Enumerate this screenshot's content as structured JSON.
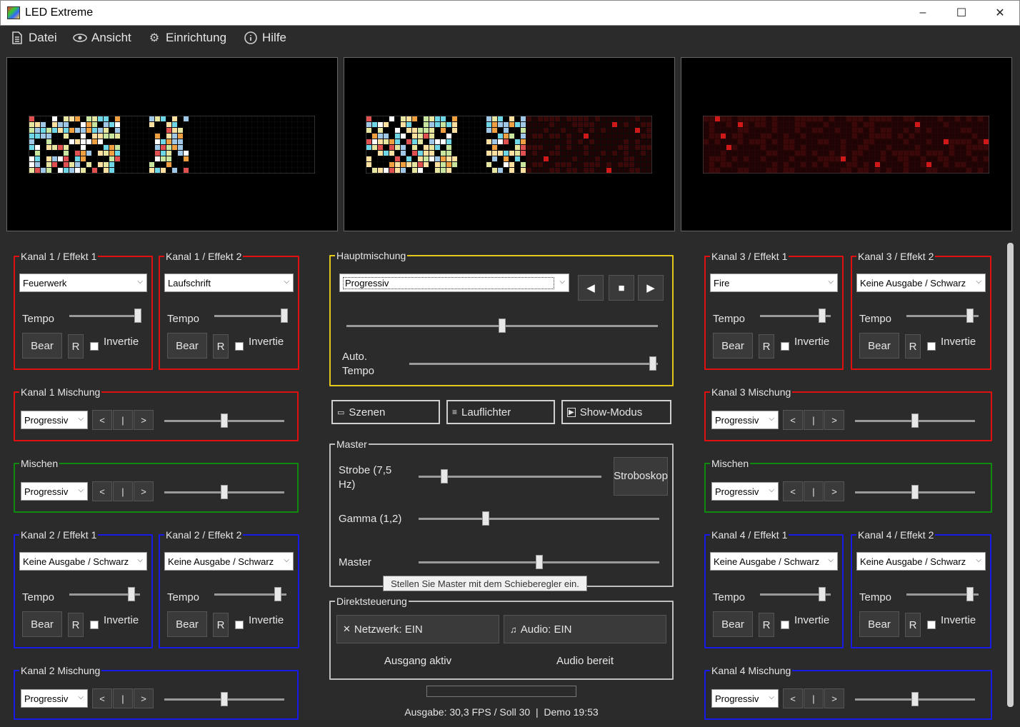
{
  "window": {
    "title": "LED Extreme",
    "minimize": "–",
    "maximize": "☐",
    "close": "✕"
  },
  "menu": [
    {
      "label": "Datei",
      "icon": "document-icon"
    },
    {
      "label": "Ansicht",
      "icon": "eye-icon"
    },
    {
      "label": "Einrichtung",
      "icon": "gear-icon"
    },
    {
      "label": "Hilfe",
      "icon": "info-icon"
    }
  ],
  "effects": {
    "k1e1": {
      "title": "Kanal 1 / Effekt 1",
      "value": "Feuerwerk",
      "tempo": 0.97
    },
    "k1e2": {
      "title": "Kanal 1 / Effekt 2",
      "value": "Laufschrift",
      "tempo": 0.97
    },
    "k2e1": {
      "title": "Kanal 2 / Effekt 1",
      "value": "Keine Ausgabe / Schwarz",
      "tempo": 0.88
    },
    "k2e2": {
      "title": "Kanal 2 / Effekt 2",
      "value": "Keine Ausgabe / Schwarz",
      "tempo": 0.88
    },
    "k3e1": {
      "title": "Kanal 3 / Effekt 1",
      "value": "Fire",
      "tempo": 0.88
    },
    "k3e2": {
      "title": "Kanal 3 / Effekt 2",
      "value": "Keine Ausgabe / Schwarz",
      "tempo": 0.88
    },
    "k4e1": {
      "title": "Kanal 4 / Effekt 1",
      "value": "Keine Ausgabe / Schwarz",
      "tempo": 0.88
    },
    "k4e2": {
      "title": "Kanal 4 / Effekt 2",
      "value": "Keine Ausgabe / Schwarz",
      "tempo": 0.88
    }
  },
  "effect_common": {
    "tempo_label": "Tempo",
    "bear_label": "Bear",
    "r_label": "R",
    "invert_label": "Invertie"
  },
  "mixes": {
    "k1mix": {
      "title": "Kanal 1 Mischung",
      "value": "Progressiv",
      "level": 0.5
    },
    "mix_left": {
      "title": "Mischen",
      "value": "Progressiv",
      "level": 0.5
    },
    "k2mix": {
      "title": "Kanal 2 Mischung",
      "value": "Progressiv",
      "level": 0.5
    },
    "k3mix": {
      "title": "Kanal 3 Mischung",
      "value": "Progressiv",
      "level": 0.5
    },
    "mix_right": {
      "title": "Mischen",
      "value": "Progressiv",
      "level": 0.5
    },
    "k4mix": {
      "title": "Kanal 4 Mischung",
      "value": "Progressiv",
      "level": 0.5
    }
  },
  "mix_common": {
    "prev": "<",
    "mid": "|",
    "next": ">"
  },
  "main_mix": {
    "title": "Hauptmischung",
    "value": "Progressiv",
    "level": 0.5,
    "auto_tempo_label": "Auto.\nTempo",
    "auto_tempo": 0.98,
    "prev": "◀",
    "stop": "■",
    "play": "▶"
  },
  "windows": [
    {
      "label": "Szenen",
      "icon": "scenes-icon"
    },
    {
      "label": "Lauflichter",
      "icon": "list-icon"
    },
    {
      "label": "Show-Modus",
      "icon": "play-box-icon"
    }
  ],
  "master": {
    "title": "Master",
    "strobe_label": "Strobe (7,5 Hz)",
    "strobe": 0.14,
    "strobe_button": "Stroboskop",
    "gamma_label": "Gamma (1,2)",
    "gamma": 0.28,
    "master_label": "Master",
    "master": 0.5,
    "tooltip": "Stellen Sie Master mit dem Schieberegler ein."
  },
  "direct": {
    "title": "Direktsteuerung",
    "network_label": "Netzwerk: EIN",
    "audio_label": "Audio: EIN",
    "network_status": "Ausgang aktiv",
    "audio_status": "Audio bereit"
  },
  "status": "Ausgabe: 30,3 FPS / Soll 30  |  Demo 19:53",
  "colors": {
    "accent_red": "#e01010",
    "accent_blue": "#1a1ae6",
    "accent_green": "#0f8a0f",
    "accent_yellow": "#e6c81a"
  }
}
